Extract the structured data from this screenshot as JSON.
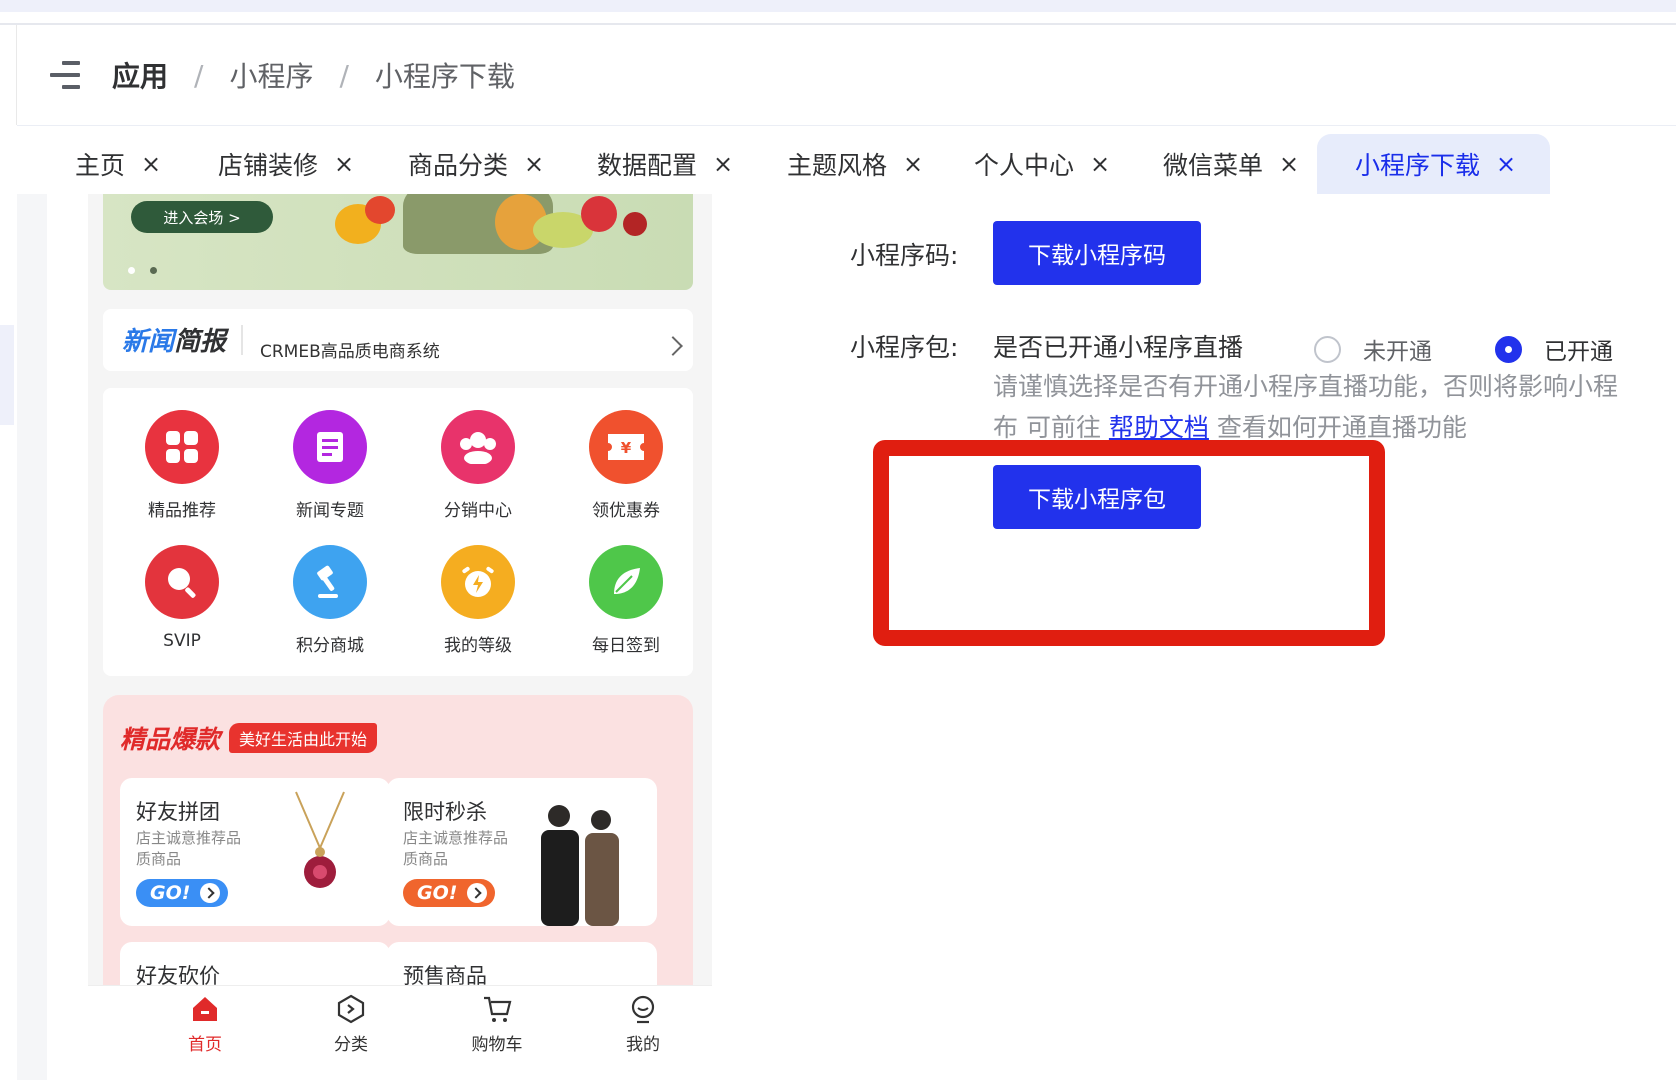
{
  "header": {
    "crumbs": [
      "应用",
      "小程序",
      "小程序下载"
    ],
    "separator": "/"
  },
  "tabs": [
    {
      "label": "主页"
    },
    {
      "label": "店铺装修"
    },
    {
      "label": "商品分类"
    },
    {
      "label": "数据配置"
    },
    {
      "label": "主题风格"
    },
    {
      "label": "个人中心"
    },
    {
      "label": "微信菜单"
    },
    {
      "label": "小程序下载",
      "active": true
    }
  ],
  "tab_close_glyph": "×",
  "preview": {
    "banner_button": "进入会场 >",
    "news_logo_a": "新闻",
    "news_logo_b": "简报",
    "news_text": "CRMEB高品质电商系统",
    "menu": [
      {
        "label": "精品推荐",
        "icon": "grid-icon",
        "color": "#e8333f"
      },
      {
        "label": "新闻专题",
        "icon": "document-icon",
        "color": "#b327e0"
      },
      {
        "label": "分销中心",
        "icon": "people-icon",
        "color": "#e8336b"
      },
      {
        "label": "领优惠券",
        "icon": "coupon-icon",
        "color": "#f0512e"
      },
      {
        "label": "SVIP",
        "icon": "search-icon",
        "color": "#e3343d"
      },
      {
        "label": "积分商城",
        "icon": "hammer-icon",
        "color": "#3ea3f0"
      },
      {
        "label": "我的等级",
        "icon": "alarm-icon",
        "color": "#f5ad20"
      },
      {
        "label": "每日签到",
        "icon": "leaf-icon",
        "color": "#4fc74a"
      }
    ],
    "hot_title": "精品爆款",
    "hot_badge": "美好生活由此开始",
    "cards": [
      {
        "title": "好友拼团",
        "sub": "店主诚意推荐品质商品",
        "go": "GO!",
        "go_color": "#3a8ff5"
      },
      {
        "title": "限时秒杀",
        "sub": "店主诚意推荐品质商品",
        "go": "GO!",
        "go_color": "#f0652d"
      },
      {
        "title": "好友砍价"
      },
      {
        "title": "预售商品"
      }
    ],
    "tabbar": [
      {
        "label": "首页",
        "icon": "home-icon",
        "active": true
      },
      {
        "label": "分类",
        "icon": "category-icon"
      },
      {
        "label": "购物车",
        "icon": "cart-icon"
      },
      {
        "label": "我的",
        "icon": "user-icon"
      }
    ]
  },
  "form": {
    "code_label": "小程序码:",
    "code_button": "下载小程序码",
    "package_label": "小程序包:",
    "live_question": "是否已开通小程序直播",
    "radio_off": "未开通",
    "radio_on": "已开通",
    "radio_selected": "已开通",
    "hint_line1": "请谨慎选择是否有开通小程序直播功能，否则将影响小程",
    "hint_prefix": "布 可前往 ",
    "hint_link": "帮助文档",
    "hint_suffix": " 查看如何开通直播功能",
    "package_button": "下载小程序包"
  },
  "colors": {
    "primary": "#2232ec",
    "highlight_box": "#e01e10"
  }
}
